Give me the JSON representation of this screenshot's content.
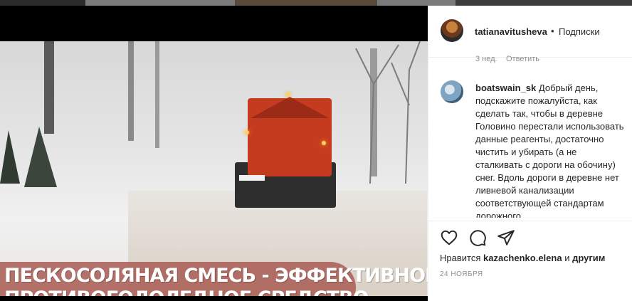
{
  "post": {
    "caption_line1": "ПЕСКОСОЛЯНАЯ СМЕСЬ - ЭФФЕКТИВНОЕ",
    "caption_line2": "ПРОТИВОГОЛОЛЕДНОЕ СРЕДСТВО",
    "caption_color": "#aa6058"
  },
  "header": {
    "username": "tatianavitusheva",
    "separator": "•",
    "follow_label": "Подписки"
  },
  "previous_comment": {
    "age": "3 нед.",
    "reply_label": "Ответить"
  },
  "comment": {
    "username": "boatswain_sk",
    "text": "Добрый день, подскажите пожалуйста, как сделать так, чтобы в деревне Головино перестали использовать данные реагенты, достаточно чистить и убирать (а не сталкивать с дороги на обочину) снег. Вдоль дороги в деревне нет ливневой канализации соответствующей стандартам дорожного"
  },
  "actions": {
    "like_icon": "heart-icon",
    "comment_icon": "comment-bubble-icon",
    "share_icon": "paper-plane-icon"
  },
  "likes": {
    "prefix": "Нравится",
    "user": "kazachenko.elena",
    "and": "и",
    "others": "другим"
  },
  "date": "24 НОЯБРЯ"
}
